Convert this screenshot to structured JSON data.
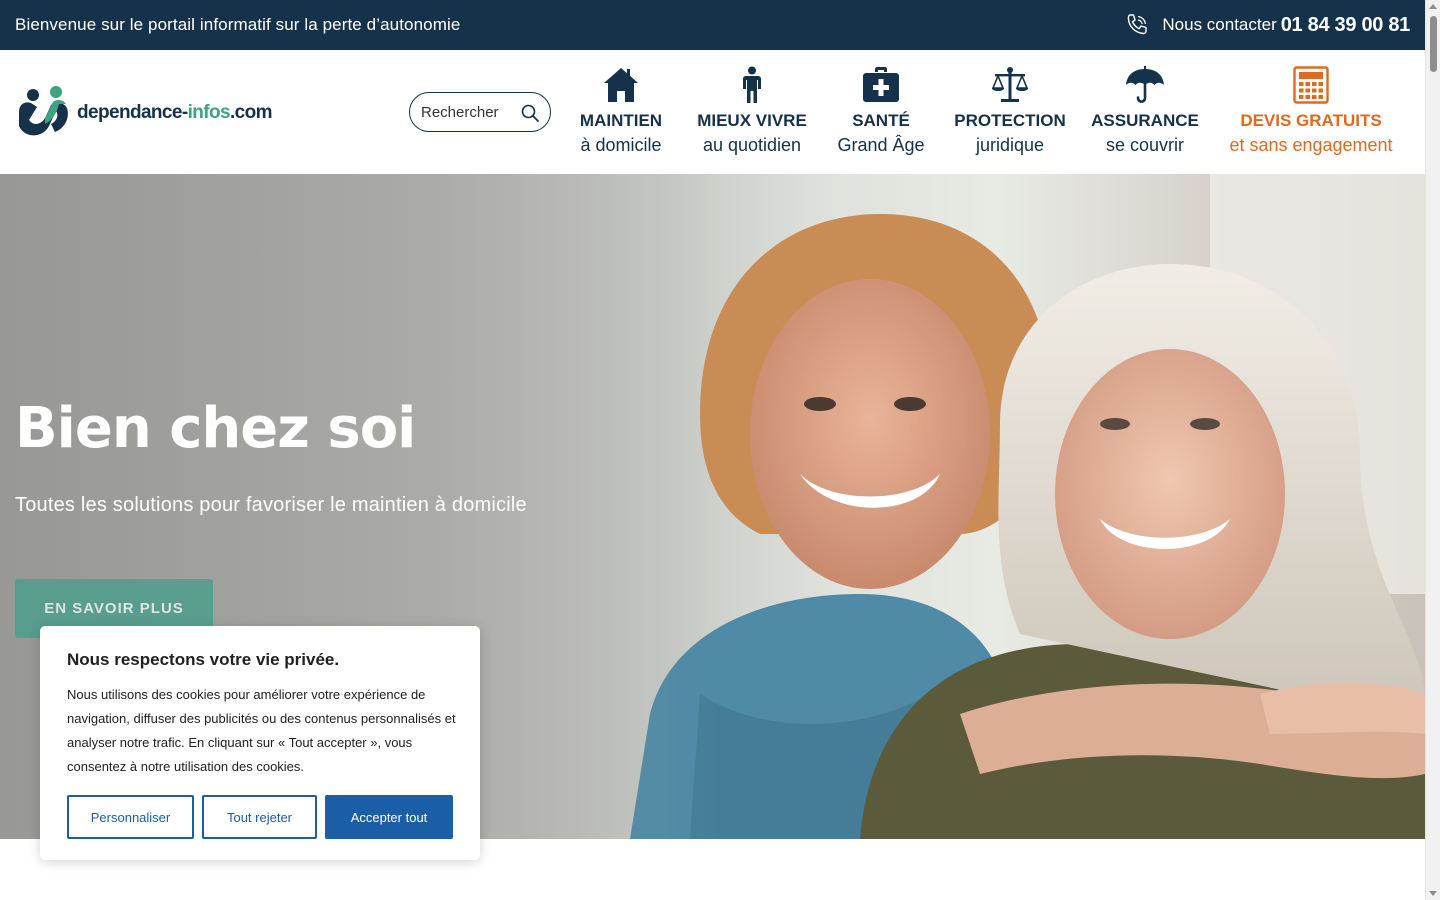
{
  "topbar": {
    "welcome": "Bienvenue sur le portail informatif sur la perte d’autonomie",
    "contact_label": "Nous contacter",
    "phone": "01 84 39 00 81",
    "phone_icon": "phone-icon"
  },
  "header": {
    "logo": {
      "text_main": "dependance-",
      "text_accent": "infos",
      "text_tld": ".com"
    },
    "search": {
      "placeholder": "Rechercher",
      "icon": "search-icon"
    },
    "nav": [
      {
        "line1": "MAINTIEN",
        "line2": "à domicile",
        "icon": "house-icon"
      },
      {
        "line1": "MIEUX VIVRE",
        "line2": "au quotidien",
        "icon": "person-icon"
      },
      {
        "line1": "SANTÉ",
        "line2": "Grand Âge",
        "icon": "medical-kit-icon"
      },
      {
        "line1": "PROTECTION",
        "line2": "juridique",
        "icon": "scales-icon"
      },
      {
        "line1": "ASSURANCE",
        "line2": "se couvrir",
        "icon": "umbrella-icon"
      },
      {
        "line1": "DEVIS GRATUITS",
        "line2": "et sans engagement",
        "icon": "calculator-icon"
      }
    ]
  },
  "colors": {
    "navy": "#15324a",
    "orange": "#e06a20",
    "green": "#3fa37f",
    "cta": "#4e9e8c",
    "cookie_blue": "#1a5ea8"
  },
  "hero": {
    "title": "Bien chez soi",
    "subtitle": "Toutes les solutions pour favoriser le maintien à domicile",
    "cta": "EN SAVOIR PLUS"
  },
  "cookie": {
    "title": "Nous respectons votre vie privée.",
    "body": "Nous utilisons des cookies pour améliorer votre expérience de navigation, diffuser des publicités ou des contenus personnalisés et analyser notre trafic. En cliquant sur « Tout accepter », vous consentez à notre utilisation des cookies.",
    "customize": "Personnaliser",
    "reject": "Tout rejeter",
    "accept": "Accepter tout"
  }
}
